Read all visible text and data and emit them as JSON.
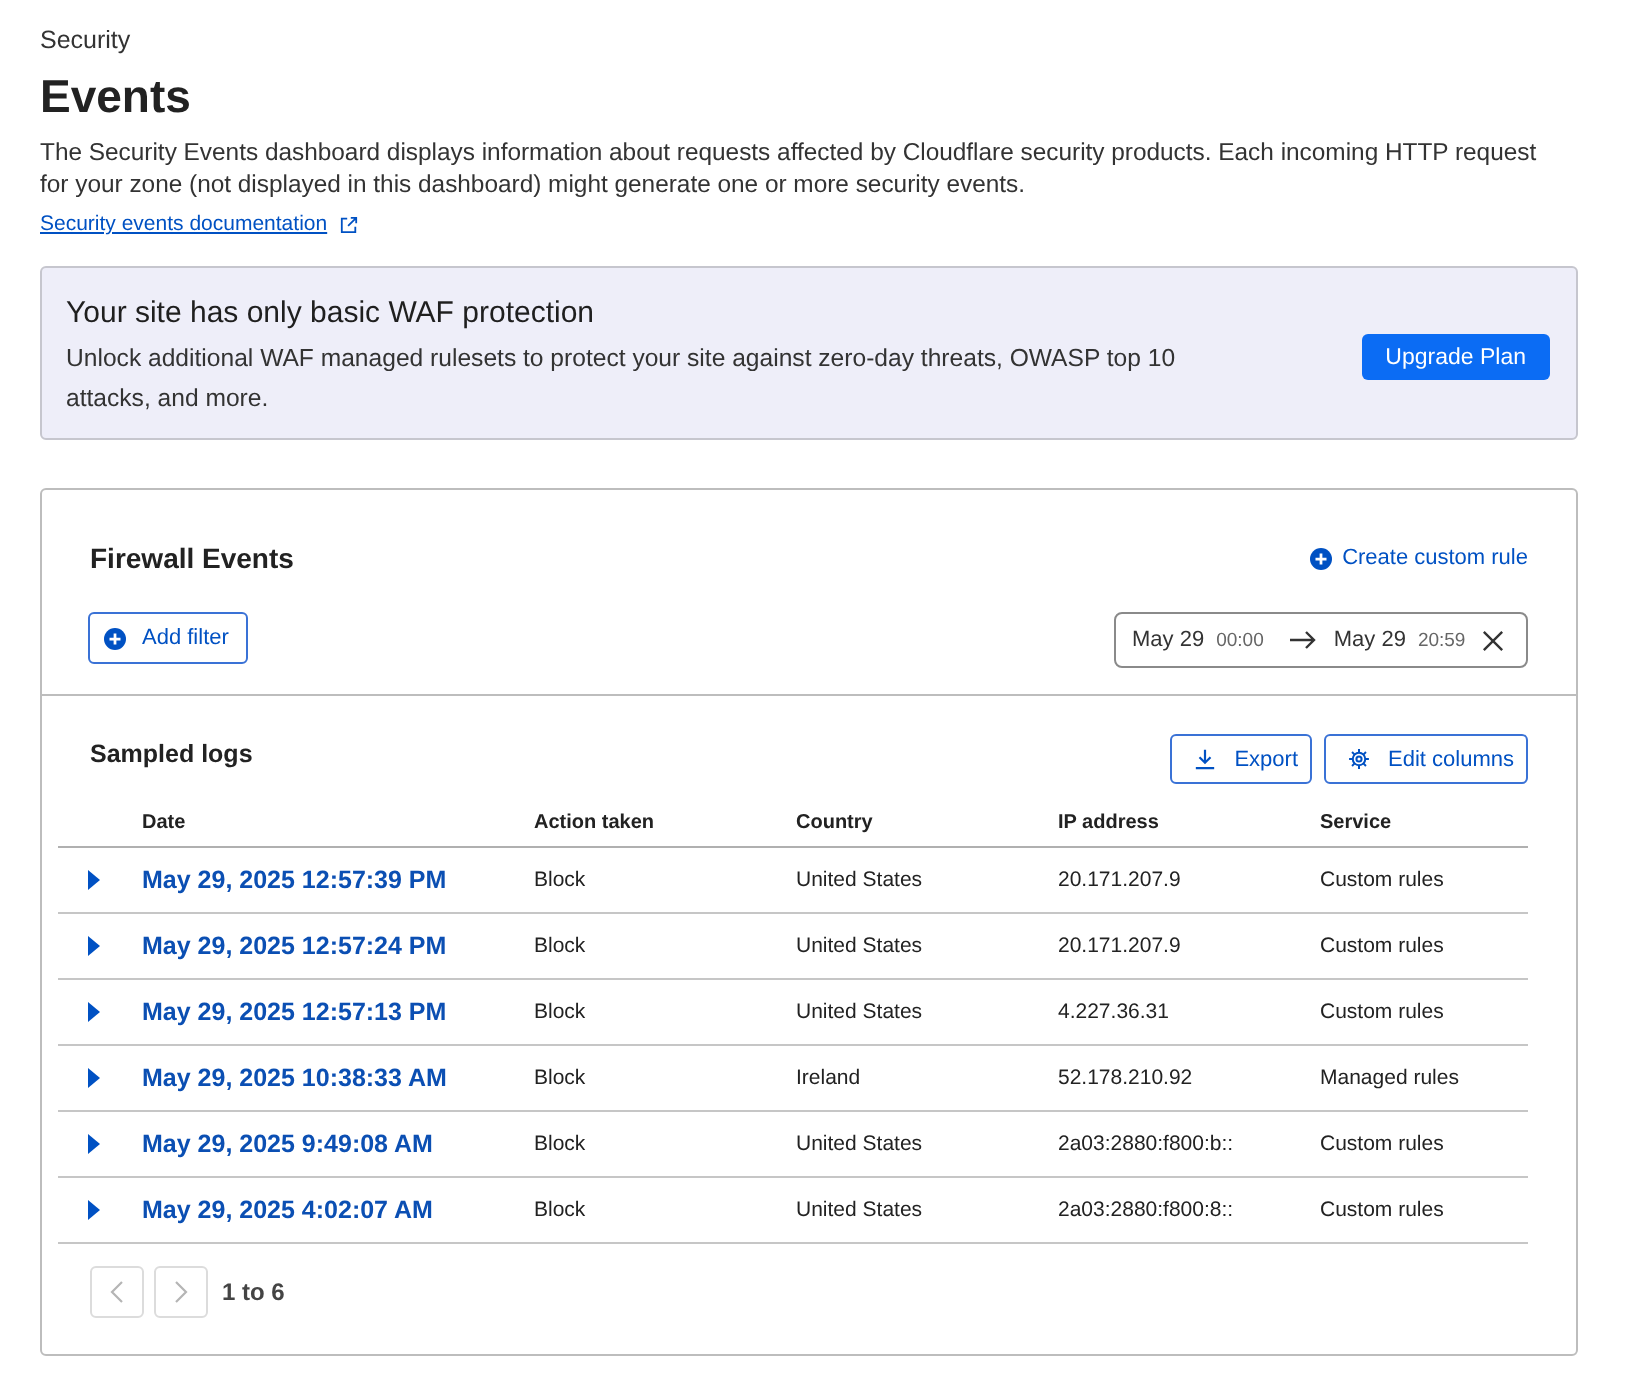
{
  "breadcrumb": "Security",
  "title": "Events",
  "description": "The Security Events dashboard displays information about requests affected by Cloudflare security products. Each incoming HTTP request for your zone (not displayed in this dashboard) might generate one or more security events.",
  "documentation_link": "Security events documentation",
  "banner": {
    "title": "Your site has only basic WAF protection",
    "text": "Unlock additional WAF managed rulesets to protect your site against zero-day threats, OWASP top 10 attacks, and more.",
    "button": "Upgrade Plan"
  },
  "firewall_events": {
    "title": "Firewall Events",
    "create_rule_link": "Create custom rule",
    "add_filter_button": "Add filter",
    "date_range": {
      "start_date": "May 29",
      "start_time": "00:00",
      "end_date": "May 29",
      "end_time": "20:59"
    }
  },
  "sampled_logs": {
    "title": "Sampled logs",
    "buttons": [
      {
        "kind": "export",
        "label": "Export"
      },
      {
        "kind": "settings",
        "label": "Edit columns"
      }
    ],
    "columns": [
      "Date",
      "Action taken",
      "Country",
      "IP address",
      "Service"
    ],
    "rows": [
      {
        "expanded": false,
        "date": "May 29, 2025 12:57:39 PM",
        "action": "Block",
        "country": "United States",
        "ip_address": "20.171.207.9",
        "service": "Custom rules"
      },
      {
        "expanded": false,
        "date": "May 29, 2025 12:57:24 PM",
        "action": "Block",
        "country": "United States",
        "ip_address": "20.171.207.9",
        "service": "Custom rules"
      },
      {
        "expanded": false,
        "date": "May 29, 2025 12:57:13 PM",
        "action": "Block",
        "country": "United States",
        "ip_address": "4.227.36.31",
        "service": "Custom rules"
      },
      {
        "expanded": false,
        "date": "May 29, 2025 10:38:33 AM",
        "action": "Block",
        "country": "Ireland",
        "ip_address": "52.178.210.92",
        "service": "Managed rules"
      },
      {
        "expanded": false,
        "date": "May 29, 2025 9:49:08 AM",
        "action": "Block",
        "country": "United States",
        "ip_address": "2a03:2880:f800:b::",
        "service": "Custom rules"
      },
      {
        "expanded": false,
        "date": "May 29, 2025 4:02:07 AM",
        "action": "Block",
        "country": "United States",
        "ip_address": "2a03:2880:f800:8::",
        "service": "Custom rules"
      }
    ],
    "pagination": {
      "previous": {
        "disabled": true
      },
      "next": {
        "disabled": true
      },
      "range": "1 to 6"
    }
  }
}
